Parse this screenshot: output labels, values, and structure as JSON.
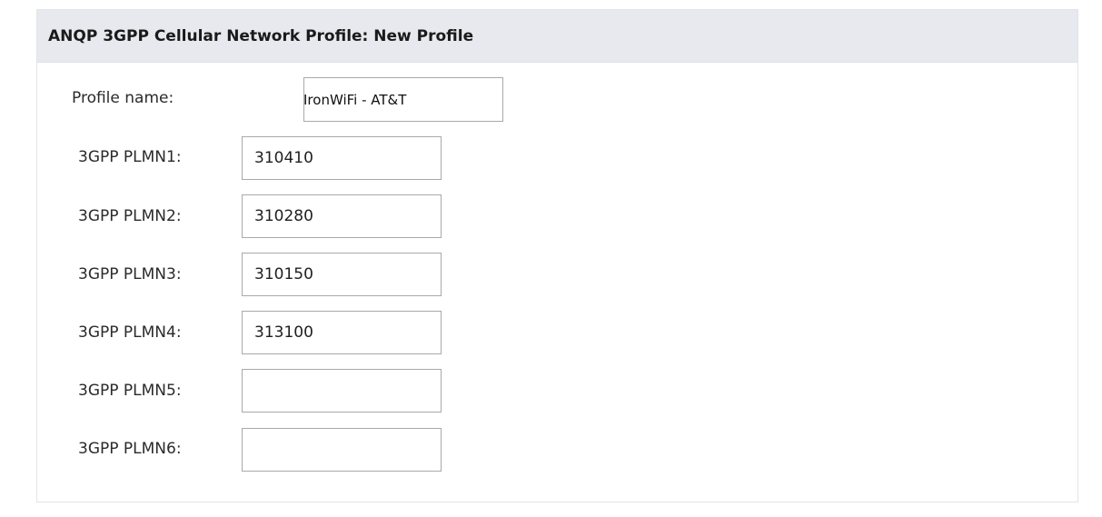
{
  "panel": {
    "title": "ANQP 3GPP Cellular Network Profile: New Profile"
  },
  "form": {
    "profile_name": {
      "label": "Profile name:",
      "value": "IronWiFi - AT&T"
    },
    "plmns": [
      {
        "label": "3GPP PLMN1:",
        "value": "310410"
      },
      {
        "label": "3GPP PLMN2:",
        "value": "310280"
      },
      {
        "label": "3GPP PLMN3:",
        "value": "310150"
      },
      {
        "label": "3GPP PLMN4:",
        "value": "313100"
      },
      {
        "label": "3GPP PLMN5:",
        "value": ""
      },
      {
        "label": "3GPP PLMN6:",
        "value": ""
      }
    ]
  }
}
